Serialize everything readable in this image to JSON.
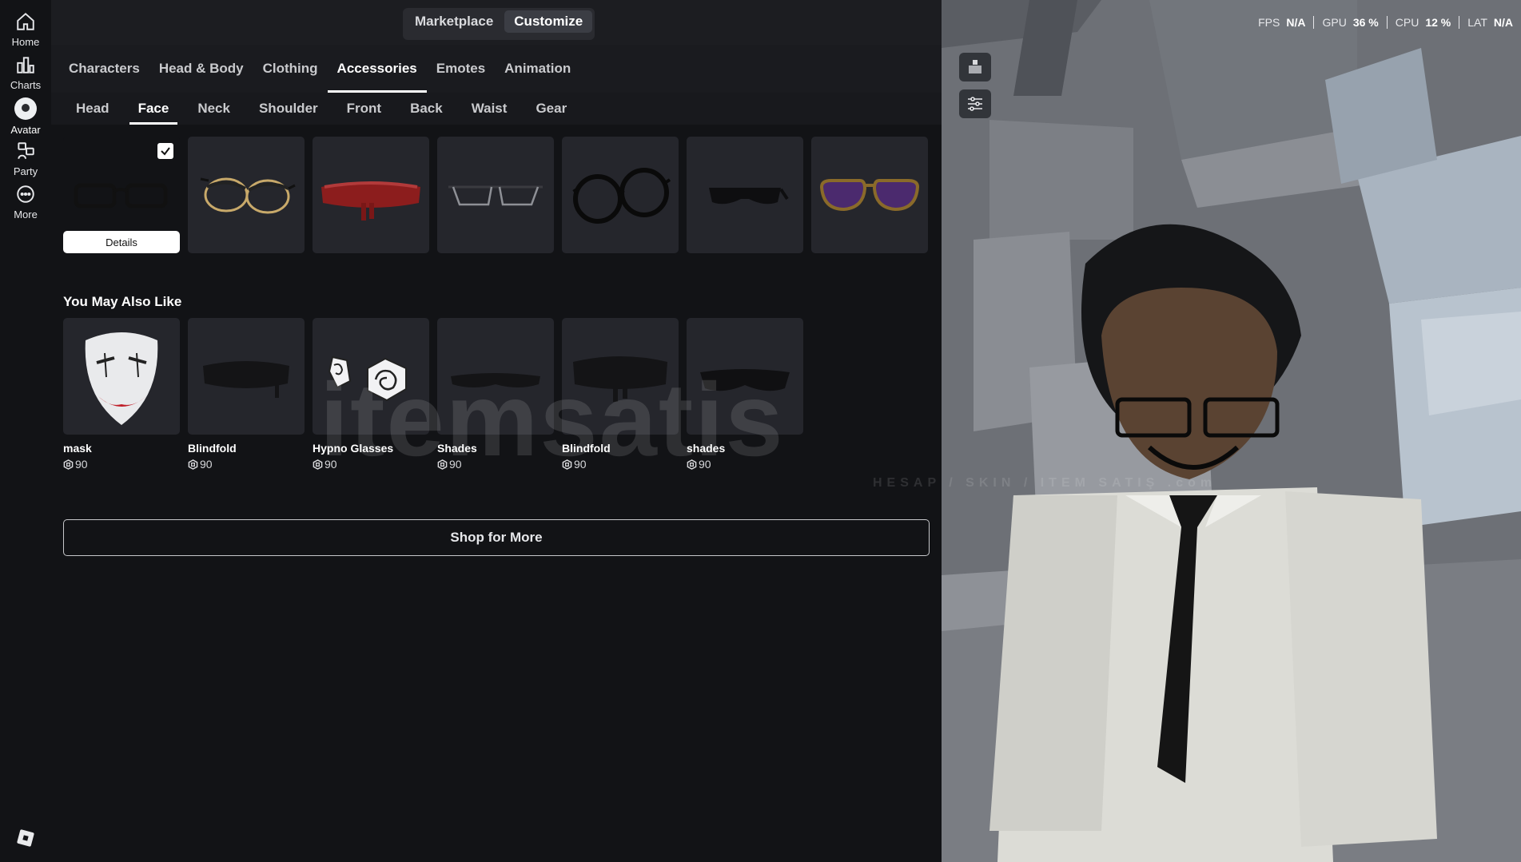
{
  "nav": {
    "items": [
      {
        "label": "Home",
        "icon": "home-icon"
      },
      {
        "label": "Charts",
        "icon": "charts-icon"
      },
      {
        "label": "Avatar",
        "icon": "avatar-icon"
      },
      {
        "label": "Party",
        "icon": "party-icon"
      },
      {
        "label": "More",
        "icon": "more-icon"
      }
    ],
    "active": "Avatar"
  },
  "header": {
    "segments": [
      "Marketplace",
      "Customize"
    ],
    "active_segment": "Customize"
  },
  "category_tabs": {
    "items": [
      "Characters",
      "Head & Body",
      "Clothing",
      "Accessories",
      "Emotes",
      "Animation"
    ],
    "active": "Accessories"
  },
  "subcategory_tabs": {
    "items": [
      "Head",
      "Face",
      "Neck",
      "Shoulder",
      "Front",
      "Back",
      "Waist",
      "Gear"
    ],
    "active": "Face"
  },
  "owned_items": {
    "selected_details_label": "Details",
    "items": [
      "black-glasses",
      "gold-round-glasses",
      "red-blindfold",
      "clear-glasses",
      "round-black-glasses",
      "black-shades",
      "purple-aviators"
    ]
  },
  "recommendations": {
    "title": "You May Also Like",
    "items": [
      {
        "name": "mask",
        "price": "90",
        "icon": "mask-icon"
      },
      {
        "name": "Blindfold",
        "price": "90",
        "icon": "blindfold-icon"
      },
      {
        "name": "Hypno Glasses",
        "price": "90",
        "icon": "hypno-glasses-icon"
      },
      {
        "name": "Shades",
        "price": "90",
        "icon": "shades-icon"
      },
      {
        "name": "Blindfold",
        "price": "90",
        "icon": "blindfold-icon"
      },
      {
        "name": "shades",
        "price": "90",
        "icon": "shades-icon"
      }
    ]
  },
  "shop_button": "Shop for More",
  "stats": {
    "fps_label": "FPS",
    "fps_value": "N/A",
    "gpu_label": "GPU",
    "gpu_value": "36 %",
    "cpu_label": "CPU",
    "cpu_value": "12 %",
    "lat_label": "LAT",
    "lat_value": "N/A"
  },
  "watermark": {
    "text": "itemsatis",
    "sub": "HESAP / SKIN / ITEM SATIŞ .com"
  },
  "colors": {
    "background": "#121316",
    "panel": "#1a1b1f",
    "tile": "#25262c",
    "accent": "#ffffff"
  }
}
